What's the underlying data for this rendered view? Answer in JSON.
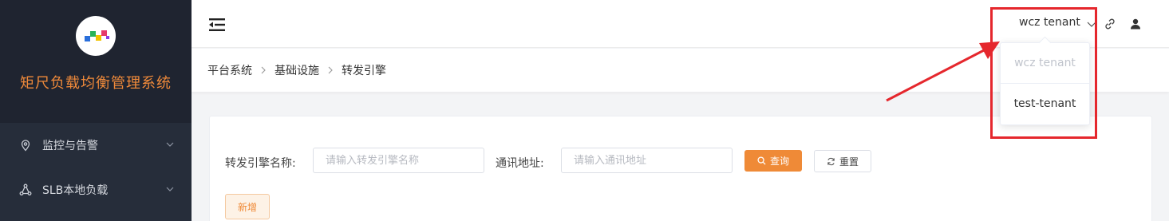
{
  "app": {
    "title": "矩尺负载均衡管理系统"
  },
  "sidebar": {
    "items": [
      {
        "label": "监控与告警",
        "icon": "location-pin-icon"
      },
      {
        "label": "SLB本地负载",
        "icon": "share-nodes-icon"
      }
    ]
  },
  "header": {
    "tenant": "wcz tenant",
    "icons": [
      "menu-fold-icon",
      "link-icon",
      "user-icon"
    ]
  },
  "breadcrumb": [
    "平台系统",
    "基础设施",
    "转发引擎"
  ],
  "filters": {
    "engine_name_label": "转发引擎名称:",
    "engine_name_placeholder": "请输入转发引擎名称",
    "address_label": "通讯地址:",
    "address_placeholder": "请输入通讯地址",
    "query_label": "查询",
    "reset_label": "重置"
  },
  "actions": {
    "add_label": "新增"
  },
  "tenant_dropdown": {
    "options": [
      {
        "label": "wcz tenant",
        "disabled": true
      },
      {
        "label": "test-tenant",
        "disabled": false
      }
    ]
  },
  "colors": {
    "accent": "#ef8a37",
    "sidebar_bg": "#262d3a",
    "annotation_red": "#e5272d"
  }
}
